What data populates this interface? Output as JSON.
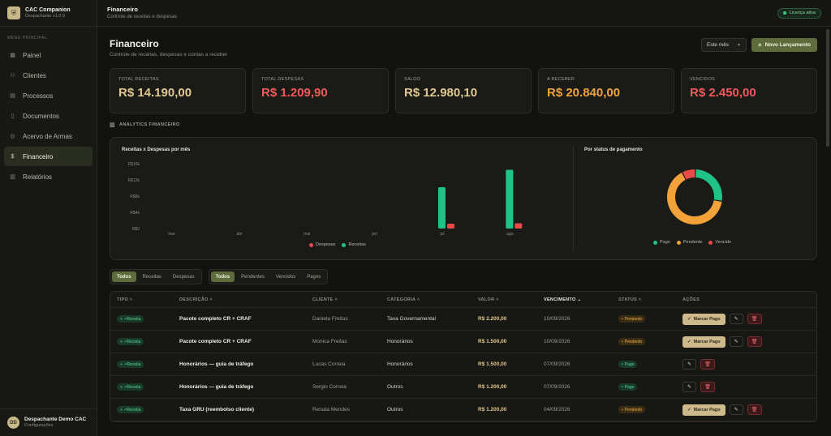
{
  "app": {
    "title": "CAC Companion",
    "version": "Despachante v1.0.9"
  },
  "sidebar": {
    "menu_label": "MENU PRINCIPAL",
    "items": [
      {
        "label": "Painel",
        "icon": "grid-icon"
      },
      {
        "label": "Clientes",
        "icon": "users-icon"
      },
      {
        "label": "Processos",
        "icon": "clipboard-icon"
      },
      {
        "label": "Documentos",
        "icon": "document-icon"
      },
      {
        "label": "Acervo de Armas",
        "icon": "target-icon"
      },
      {
        "label": "Financeiro",
        "icon": "dollar-icon",
        "active": true
      },
      {
        "label": "Relatórios",
        "icon": "chart-icon"
      }
    ],
    "user": {
      "initials": "DD",
      "name": "Despachante Demo CAC",
      "sub": "Configurações"
    }
  },
  "topbar": {
    "title": "Financeiro",
    "subtitle": "Controle de receitas e despesas",
    "license": "Licença ativa"
  },
  "page": {
    "title": "Financeiro",
    "subtitle": "Controle de receitas, despesas e contas a receber",
    "period": "Este mês",
    "new_button": "Novo Lançamento"
  },
  "kpis": [
    {
      "label": "TOTAL RECEITAS",
      "value": "R$ 14.190,00",
      "color": "#e0c890"
    },
    {
      "label": "TOTAL DESPESAS",
      "value": "R$ 1.209,90",
      "color": "#f05a5a"
    },
    {
      "label": "SALDO",
      "value": "R$ 12.980,10",
      "color": "#e0c890"
    },
    {
      "label": "A RECEBER",
      "value": "R$ 20.840,00",
      "color": "#f3a23a"
    },
    {
      "label": "VENCIDOS",
      "value": "R$ 2.450,00",
      "color": "#f05a5a"
    }
  ],
  "analytics_label": "ANALYTICS FINANCEIRO",
  "chart_data": [
    {
      "type": "bar",
      "title": "Receitas x Despesas por mês",
      "categories": [
        "mar",
        "abr",
        "mai",
        "jun",
        "jul",
        "ago"
      ],
      "y_ticks": [
        "R$16k",
        "R$12k",
        "R$8k",
        "R$4k",
        "R$0"
      ],
      "ylim": [
        0,
        16000
      ],
      "series": [
        {
          "name": "Despesas",
          "color": "#e84a4a",
          "values": [
            0,
            0,
            0,
            0,
            1200,
            1300
          ]
        },
        {
          "name": "Receitas",
          "color": "#1fc388",
          "values": [
            0,
            0,
            0,
            0,
            10200,
            14500
          ]
        }
      ],
      "legend_position": "bottom"
    },
    {
      "type": "pie",
      "title": "Por status de pagamento",
      "donut": true,
      "slices": [
        {
          "name": "Pago",
          "color": "#1fc388",
          "value": 27
        },
        {
          "name": "Pendente",
          "color": "#f3a23a",
          "value": 65
        },
        {
          "name": "Vencido",
          "color": "#e84a4a",
          "value": 8
        }
      ],
      "legend_position": "bottom"
    }
  ],
  "filters": {
    "type": [
      {
        "label": "Todos",
        "active": true
      },
      {
        "label": "Receitas"
      },
      {
        "label": "Despesas"
      }
    ],
    "status": [
      {
        "label": "Todos",
        "active": true
      },
      {
        "label": "Pendentes"
      },
      {
        "label": "Vencidos"
      },
      {
        "label": "Pagos"
      }
    ]
  },
  "table": {
    "headers": [
      "TIPO",
      "DESCRIÇÃO",
      "CLIENTE",
      "CATEGORIA",
      "VALOR",
      "VENCIMENTO",
      "STATUS",
      "AÇÕES"
    ],
    "mark_paid_label": "Marcar Pago",
    "rows": [
      {
        "type": "Receita",
        "desc": "Pacote completo CR + CRAF",
        "client": "Daniela Freitas",
        "category": "Taxa Governamental",
        "value": "R$ 2.200,00",
        "due": "10/09/2026",
        "status": "Pendente",
        "paid": false
      },
      {
        "type": "Receita",
        "desc": "Pacote completo CR + CRAF",
        "client": "Monica Freitas",
        "category": "Honorários",
        "value": "R$ 1.500,00",
        "due": "10/09/2026",
        "status": "Pendente",
        "paid": false
      },
      {
        "type": "Receita",
        "desc": "Honorários — guia de tráfego",
        "client": "Lucas Correia",
        "category": "Honorários",
        "value": "R$ 1.500,00",
        "due": "07/09/2026",
        "status": "Pago",
        "paid": true
      },
      {
        "type": "Receita",
        "desc": "Honorários — guia de tráfego",
        "client": "Sergio Correia",
        "category": "Outros",
        "value": "R$ 1.200,00",
        "due": "07/09/2026",
        "status": "Pago",
        "paid": true
      },
      {
        "type": "Receita",
        "desc": "Taxa GRU (reembolso cliente)",
        "client": "Renata Mendes",
        "category": "Outros",
        "value": "R$ 1.200,00",
        "due": "04/09/2026",
        "status": "Pendente",
        "paid": false
      }
    ]
  }
}
